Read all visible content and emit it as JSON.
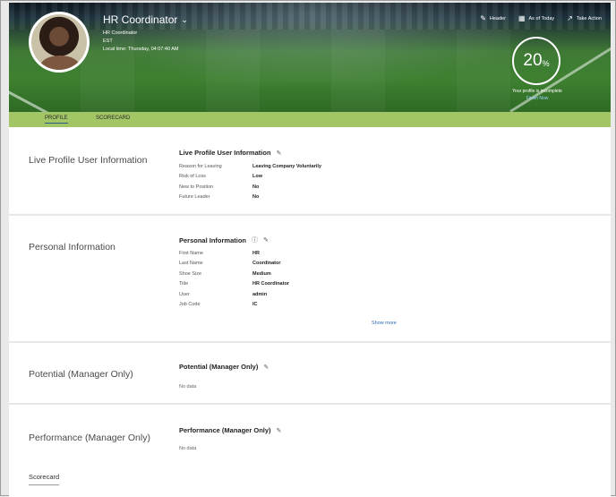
{
  "header": {
    "user_name": "HR Coordinator",
    "title": "HR Coordinator",
    "timezone": "EST",
    "local_time": "Local time: Thursday, 04:07:40 AM",
    "actions": [
      {
        "label": "Header",
        "icon": "pencil-icon"
      },
      {
        "label": "As of Today",
        "icon": "calendar-icon"
      },
      {
        "label": "Take Action",
        "icon": "external-action-icon"
      }
    ],
    "profile_completion": {
      "value": "20",
      "unit": "%",
      "fraction": 0.2
    },
    "incomplete_text": "Your profile is incomplete",
    "finish_link": "Finish Now"
  },
  "tabs": [
    {
      "label": "PROFILE",
      "active": true
    },
    {
      "label": "SCORECARD",
      "active": false
    }
  ],
  "sections": {
    "live_profile": {
      "title": "Live Profile User Information",
      "card_title": "Live Profile User Information",
      "rows": [
        {
          "label": "Reason for Leaving",
          "value": "Leaving Company Voluntarily"
        },
        {
          "label": "Risk of Loss",
          "value": "Low"
        },
        {
          "label": "New to Position",
          "value": "No"
        },
        {
          "label": "Future Leader",
          "value": "No"
        }
      ]
    },
    "personal": {
      "title": "Personal Information",
      "card_title": "Personal Information",
      "rows": [
        {
          "label": "First Name",
          "value": "HR"
        },
        {
          "label": "Last Name",
          "value": "Coordinator"
        },
        {
          "label": "Shoe Size",
          "value": "Medium"
        },
        {
          "label": "Title",
          "value": "HR Coordinator"
        },
        {
          "label": "User",
          "value": "admin"
        },
        {
          "label": "Job Code",
          "value": "IC"
        }
      ],
      "show_more": "Show more"
    },
    "potential": {
      "title": "Potential (Manager Only)",
      "card_title": "Potential (Manager Only)",
      "no_data": "No data"
    },
    "performance": {
      "title": "Performance (Manager Only)",
      "card_title": "Performance (Manager Only)",
      "no_data": "No data",
      "scorecard_label": "Scorecard"
    }
  }
}
